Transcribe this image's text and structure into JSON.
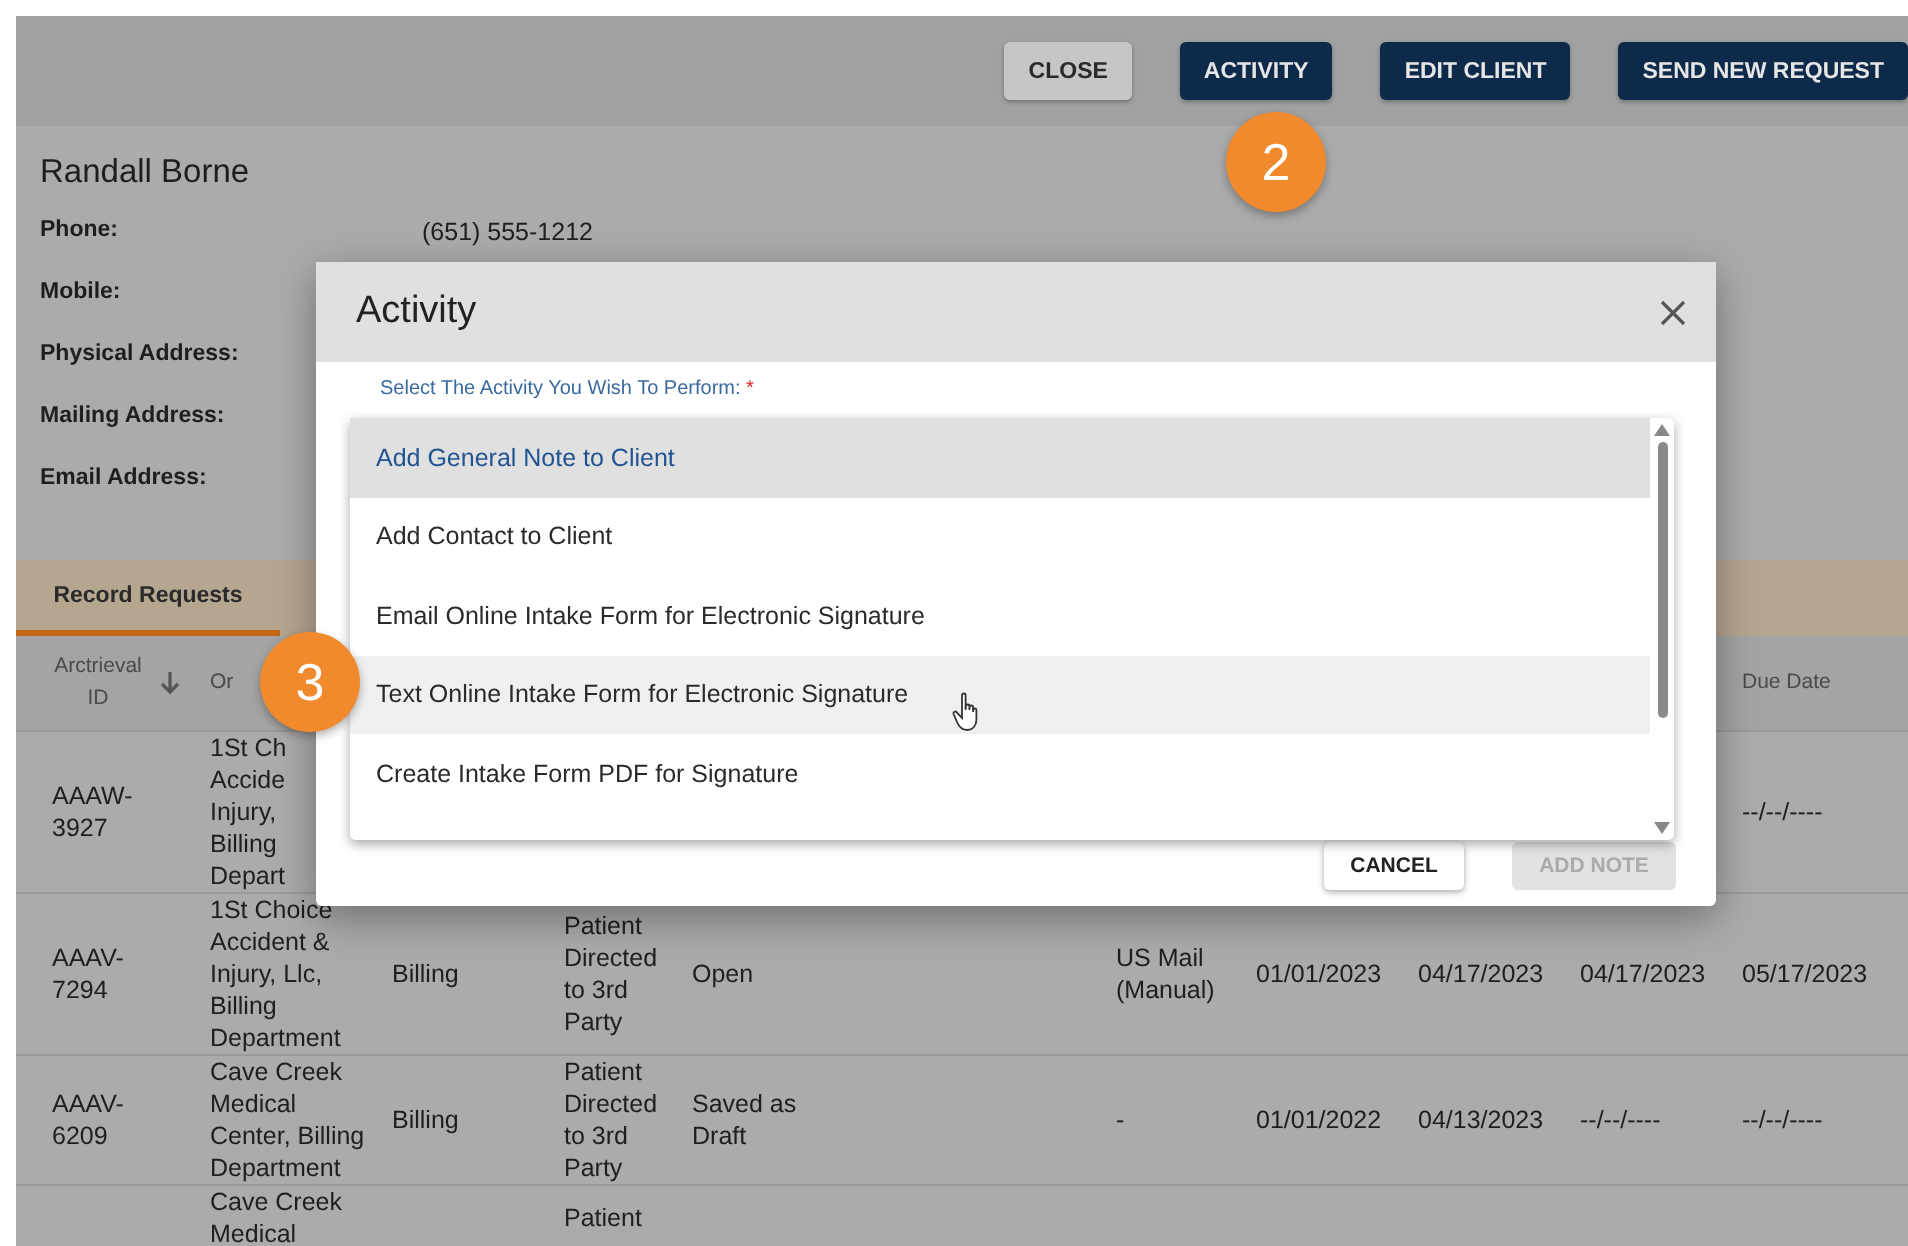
{
  "header_buttons": [
    {
      "label": "CLOSE",
      "kind": "secondary"
    },
    {
      "label": "ACTIVITY",
      "kind": "primary"
    },
    {
      "label": "EDIT CLIENT",
      "kind": "primary"
    },
    {
      "label": "SEND NEW REQUEST",
      "kind": "primary"
    }
  ],
  "client": {
    "name": "Randall Borne",
    "fields": [
      {
        "label": "Phone:",
        "value": "(651) 555-1212"
      },
      {
        "label": "Mobile:"
      },
      {
        "label": "Physical Address:"
      },
      {
        "label": "Mailing Address:"
      },
      {
        "label": "Email Address:"
      }
    ]
  },
  "tabs": [
    {
      "label": "Record Requests",
      "selected": true
    }
  ],
  "table": {
    "columns": {
      "column_1": {
        "label": "Arctrieval ID",
        "sorted": true
      },
      "column_2": {
        "label": "Or",
        "sorted": false
      },
      "column_10": {
        "label": "Due Date",
        "sorted": false
      }
    },
    "rows": [
      [
        "AAAW-\n3927",
        "1St Ch\nAccide\nInjury,\nBilling\nDepart",
        null,
        null,
        null,
        null,
        null,
        null,
        null,
        "--/--/----"
      ],
      [
        "AAAV-\n7294",
        "1St Choice Accident & Injury, Llc, Billing Department",
        "Billing",
        "Patient Directed to 3rd Party",
        "Open",
        "US Mail (Manual)",
        "01/01/2023",
        "04/17/2023",
        "04/17/2023",
        "05/17/2023"
      ],
      [
        "AAAV-\n6209",
        "Cave Creek Medical Center, Billing Department",
        "Billing",
        "Patient Directed to 3rd Party",
        "Saved as Draft",
        "-",
        "01/01/2022",
        "04/13/2023",
        "--/--/----",
        "--/--/----"
      ],
      [
        null,
        "Cave Creek Medical",
        null,
        "Patient",
        null,
        null,
        null,
        null,
        null,
        null
      ]
    ]
  },
  "dialog": {
    "title": "Activity",
    "field_label": "Select The Activity You Wish To Perform:",
    "required_mark": "*",
    "options": [
      {
        "label": "Add General Note to Client",
        "selected": true,
        "hovered": false
      },
      {
        "label": "Add Contact to Client",
        "selected": false,
        "hovered": false
      },
      {
        "label": "Email Online Intake Form for Electronic Signature",
        "selected": false,
        "hovered": false
      },
      {
        "label": "Text Online Intake Form for Electronic Signature",
        "selected": false,
        "hovered": true
      },
      {
        "label": "Create Intake Form PDF for Signature",
        "selected": false,
        "hovered": false
      }
    ],
    "buttons": [
      {
        "label": "CANCEL",
        "disabled": false
      },
      {
        "label": "ADD NOTE",
        "disabled": true
      }
    ]
  },
  "step_badges": [
    "2",
    "3"
  ]
}
